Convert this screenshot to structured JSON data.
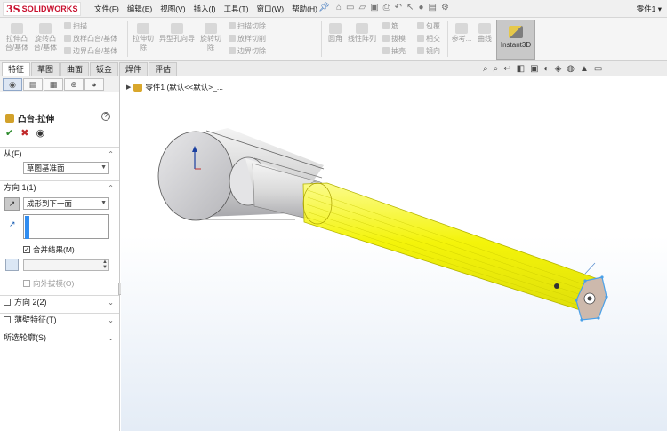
{
  "app": {
    "logo_ds": "3S",
    "logo_text": "SOLIDWORKS",
    "document_title": "零件1 ▾"
  },
  "menu": [
    "文件(F)",
    "编辑(E)",
    "视图(V)",
    "插入(I)",
    "工具(T)",
    "窗口(W)",
    "帮助(H)"
  ],
  "ribbon": {
    "extrude_boss": "拉伸凸台/基体",
    "revolve_boss": "旋转凸台/基体",
    "sweep": "扫描",
    "loft_boss": "放样凸台/基体",
    "boundary_boss": "边界凸台/基体",
    "extrude_cut": "拉伸切除",
    "hole_wizard": "异型孔向导",
    "revolve_cut": "旋转切除",
    "swept_cut": "扫描切除",
    "lofted_cut": "放样切削",
    "boundary_cut": "边界切除",
    "fillet": "圆角",
    "linear_pattern": "线性阵列",
    "rib": "筋",
    "draft": "拔模",
    "shell": "抽壳",
    "wrap": "包覆",
    "intersect": "相交",
    "mirror": "镜向",
    "reference": "参考...",
    "curves": "曲线",
    "instant3d": "Instant3D"
  },
  "tabs": [
    "特征",
    "草图",
    "曲面",
    "钣金",
    "焊件",
    "评估"
  ],
  "panel": {
    "title": "凸台-拉伸",
    "from_label": "从(F)",
    "from_value": "草图基准面",
    "direction1_label": "方向 1(1)",
    "end_condition": "成形到下一面",
    "merge_result": "合并结果(M)",
    "draft_outward": "向外拔模(O)",
    "direction2_label": "方向 2(2)",
    "thin_feature_label": "薄壁特征(T)",
    "selected_contours_label": "所选轮廓(S)"
  },
  "tree": {
    "root": "零件1 (默认<<默认>_..."
  },
  "colors": {
    "highlight": "#f4f40a",
    "accent": "#2f8cf0",
    "brand": "#c8102e"
  }
}
